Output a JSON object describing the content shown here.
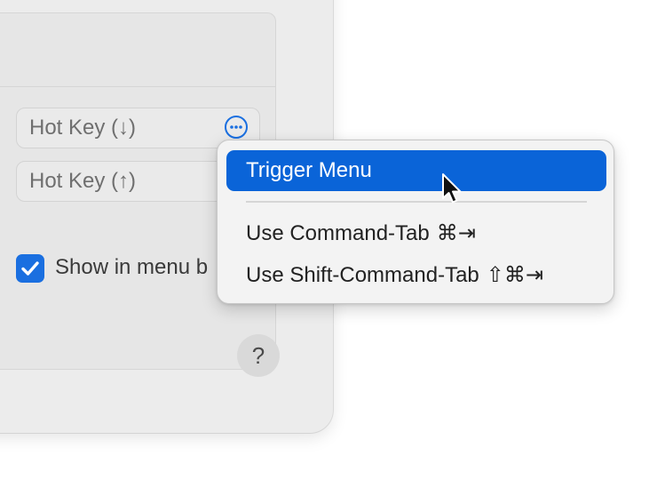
{
  "settings": {
    "hotkey_down_placeholder": "Hot Key (↓)",
    "hotkey_up_placeholder": "Hot Key (↑)",
    "show_in_menu_bar_label": "Show in menu b",
    "show_in_menu_bar_checked": true,
    "help_label": "?"
  },
  "menu": {
    "items": [
      {
        "label": "Trigger Menu",
        "shortcut": "",
        "selected": true
      },
      {
        "label": "Use Command-Tab",
        "shortcut": "⌘⇥",
        "selected": false
      },
      {
        "label": "Use Shift-Command-Tab",
        "shortcut": "⇧⌘⇥",
        "selected": false
      }
    ]
  },
  "colors": {
    "accent": "#0a64d8",
    "window_bg": "#ececec",
    "menu_bg": "#f3f3f3"
  },
  "icons": {
    "more": "ellipsis-circle-icon",
    "checkbox": "checkmark-icon",
    "cursor": "arrow-pointer-icon"
  }
}
